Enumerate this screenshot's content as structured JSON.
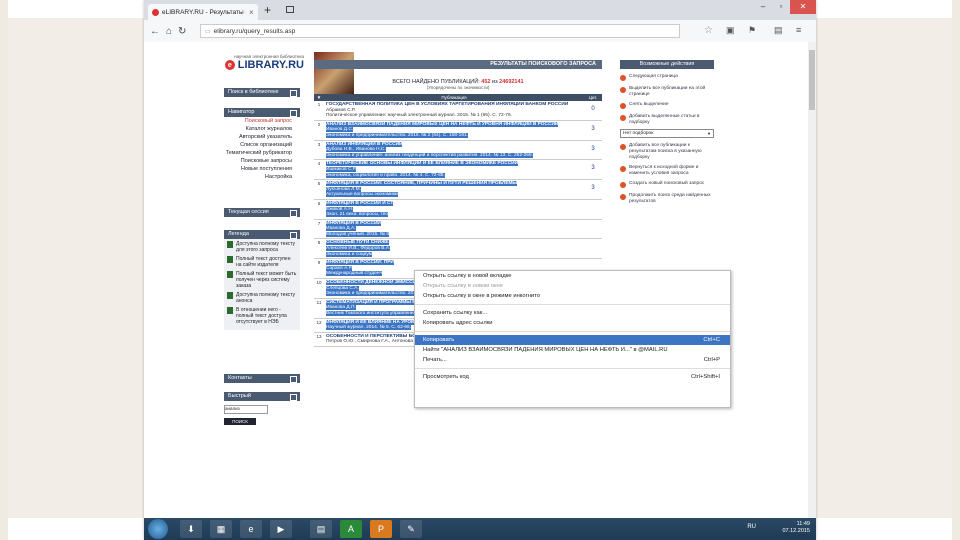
{
  "browser": {
    "tab_title": "eLIBRARY.RU - Результаты поис",
    "url": "elibrary.ru/query_results.asp",
    "window_controls": [
      "–",
      "▫",
      "✕"
    ]
  },
  "site": {
    "logo_small": "научная электронная библиотека",
    "logo_text": "LIBRARY.RU",
    "logo_mark": "e"
  },
  "left": {
    "search_header": "Поиск в библиотеке",
    "navigator_header": "Навигатор",
    "menu": [
      {
        "label": "Поисковый запрос",
        "red": true
      },
      {
        "label": "Каталог журналов",
        "red": false
      },
      {
        "label": "Авторский указатель",
        "red": false
      },
      {
        "label": "Список организаций",
        "red": false
      },
      {
        "label": "Тематический рубрикатор",
        "red": false
      },
      {
        "label": "Поисковые запросы",
        "red": false
      },
      {
        "label": "Новые поступления",
        "red": false
      },
      {
        "label": "Настройка",
        "red": false
      }
    ],
    "sessions_header": "Текущая сессия",
    "legend_header": "Легенда",
    "legend": [
      "Доступна полному тексту для этого запроса",
      "Полный текст доступен на сайте издателя",
      "Полный текст может быть получен через систему заказа",
      "Доступна полному тексту анонса",
      "В отношении него - полный текст доступа отсутствует в НЭБ"
    ],
    "contacts_header": "Контакты",
    "find_header": "Быстрый",
    "find_value": "анализ",
    "find_button": "ПОИСК"
  },
  "results": {
    "header": "РЕЗУЛЬТАТЫ ПОИСКОВОГО ЗАПРОСА",
    "found_prefix": "ВСЕГО НАЙДЕНО ПУБЛИКАЦИЙ:",
    "found_count": "452",
    "found_mid": "из",
    "found_total": "24692141",
    "sort_note": "(Упорядочены по значимости)",
    "col_publication": "Публикация",
    "col_cited": "Цит.",
    "rows": [
      {
        "n": "1",
        "title": "ГОСУДАРСТВЕННАЯ ПОЛИТИКА ЦЕН В УСЛОВИЯХ ТАРГЕТИРОВАНИЯ ИНФЛЯЦИИ БАНКОМ РОССИИ",
        "authors": "Абрамов С.Р.",
        "source": "Политическое управление: научный электронный журнал. 2015. № 1 (65). С. 72-76.",
        "cited": "0",
        "sel": false
      },
      {
        "n": "2",
        "title": "АНАЛИЗ ВЗАИМОСВЯЗИ ПАДЕНИЯ МИРОВЫХ ЦЕН НА НЕФТЬ И УРОВНЯ ИНФЛЯЦИИ В РОССИИ",
        "authors": "Иванов Д.С.",
        "source": "Экономика и предпринимательство. 2015. № 2 (54). С. 158-161.",
        "cited": "3",
        "sel": true
      },
      {
        "n": "3",
        "title": "АНАЛИЗ ИНФЛЯЦИИ В РОССИИ",
        "authors": "Дубова Н.В., Иванова Н.С.",
        "source": "Экономика и управление: анализ тенденций и перспектив развития. 2014. № 13. С. 252-256.",
        "cited": "3",
        "sel": true
      },
      {
        "n": "4",
        "title": "ТЕОРЕТИЧЕСКИЕ ОСНОВЫ ИНФЛЯЦИИ И ЕЁ ВЛИЯНИЕ В ЭКОНОМИКЕ РОССИИ",
        "authors": "Ишмаков С.Р.",
        "source": "Экономика, социология и право. 2014. № 4. С. 72-85.",
        "cited": "3",
        "sel": true
      },
      {
        "n": "5",
        "title": "ИНФЛЯЦИЯ В РОССИИ: СОСТОЯНИЕ, ПРИЧИНЫ И ПУТИ РЕШЕНИЯ ПРОБЛЕМЫ",
        "authors": "Лукъянова Л.М.",
        "source": "Актуальные вопросы экономики",
        "cited": "3",
        "sel": true
      },
      {
        "n": "6",
        "title": "ИНФЛЯЦИЯ В РОССИИ И СТ",
        "authors": "Ёжиков А.Н.",
        "source": "Экон. 21 века: вопросы, тео",
        "cited": "",
        "sel": true
      },
      {
        "n": "7",
        "title": "ИНФЛЯЦИЯ В РОССИИ",
        "authors": "Иванова Д.А.",
        "source": "Молодой учёный. 2015. № 8",
        "cited": "",
        "sel": true
      },
      {
        "n": "8",
        "title": "ОСНОВНЫЕ ПУТИ СНИЖЕ",
        "authors": "Алексеев И.В., Федоров В.А.",
        "source": "Экономика и социум",
        "cited": "",
        "sel": true
      },
      {
        "n": "9",
        "title": "ИНФЛЯЦИЯ В РОССИИ: ПРИ",
        "authors": "Сараев А.Р.",
        "source": "Международный студенч",
        "cited": "",
        "sel": true
      },
      {
        "n": "10",
        "title": "ОСОБЕННОСТИ ДЕНЕЖНОЙ ЭМИССИИ И ИНФЛЯЦИИ В РОССИИ",
        "authors": "Слепцова С.А.",
        "source": "Экономика и предпринимательство. 2015. № 8 (61). С. 290-296.",
        "cited": "3",
        "sel": true
      },
      {
        "n": "11",
        "title": "СИСТЕМАТИЗАЦИЯ И ПРОГРАММЫ БОРЬБЫ С ИНФЛЯЦИЕЙ В РОССИИ НА СОВРЕМЕННОМ ЭТАПЕ",
        "authors": "Иванова Д.П.",
        "source": "Вестник Томского института управления, бизнеса и права. 2015. № 1. С. 42-58.",
        "cited": "3",
        "sel": true
      },
      {
        "n": "12",
        "title": "ИНФЛЯЦИЯ И ЕЕ ВЛИЯНИЕ НА УРОВЕНЬ ЖИЗНИ НАСЕЛЕНИЯ В РОССИИ",
        "authors": "",
        "source": "Научный журнал. 2014. № 5. С. 62-66.",
        "cited": "0",
        "sel": true
      },
      {
        "n": "13",
        "title": "ОСОБЕННОСТИ И ПЕРСПЕКТИВЫ БОРЬБЫ С ИНФЛЯЦИЕЙ В РОССИИ",
        "authors": "Петров О.Ю., Смирнова Г.А., Антонова В.В.",
        "source": "",
        "cited": "",
        "sel": false
      }
    ]
  },
  "right": {
    "header": "Возможные действия",
    "actions": [
      "Следующая страница",
      "Выделить все публикации на этой странице",
      "Снять выделение",
      "Добавить выделенные статьи в подборку"
    ],
    "select_value": "Нет подборок",
    "actions2": [
      "Добавить все публикации к результатам поиска в указанную подборку",
      "Вернуться к исходной форме и изменить условия запроса",
      "Создать новый поисковый запрос",
      "Продолжить поиск среди найденных результатов"
    ]
  },
  "context_menu": {
    "items": [
      {
        "label": "Открыть ссылку в новой вкладке",
        "shortcut": "",
        "disabled": false,
        "hl": false
      },
      {
        "label": "Открыть ссылку в новом окне",
        "shortcut": "",
        "disabled": true,
        "hl": false
      },
      {
        "label": "Открыть ссылку в окне в режиме инкогнито",
        "shortcut": "",
        "disabled": false,
        "hl": false
      },
      {
        "sep": true
      },
      {
        "label": "Сохранить ссылку как...",
        "shortcut": "",
        "disabled": false,
        "hl": false
      },
      {
        "label": "Копировать адрес ссылки",
        "shortcut": "",
        "disabled": false,
        "hl": false
      },
      {
        "sep": true
      },
      {
        "label": "Копировать",
        "shortcut": "Ctrl+C",
        "disabled": false,
        "hl": true
      },
      {
        "label": "Найти \"АНАЛИЗ ВЗАИМОСВЯЗИ ПАДЕНИЯ МИРОВЫХ ЦЕН НА НЕФТЬ И...\" в @MAIL.RU",
        "shortcut": "",
        "disabled": false,
        "hl": false
      },
      {
        "label": "Печать...",
        "shortcut": "Ctrl+P",
        "disabled": false,
        "hl": false
      },
      {
        "sep": true
      },
      {
        "label": "Просмотреть код",
        "shortcut": "Ctrl+Shift+I",
        "disabled": false,
        "hl": false
      }
    ]
  },
  "taskbar": {
    "lang": "RU",
    "time": "11:49",
    "date": "07.12.2015"
  }
}
